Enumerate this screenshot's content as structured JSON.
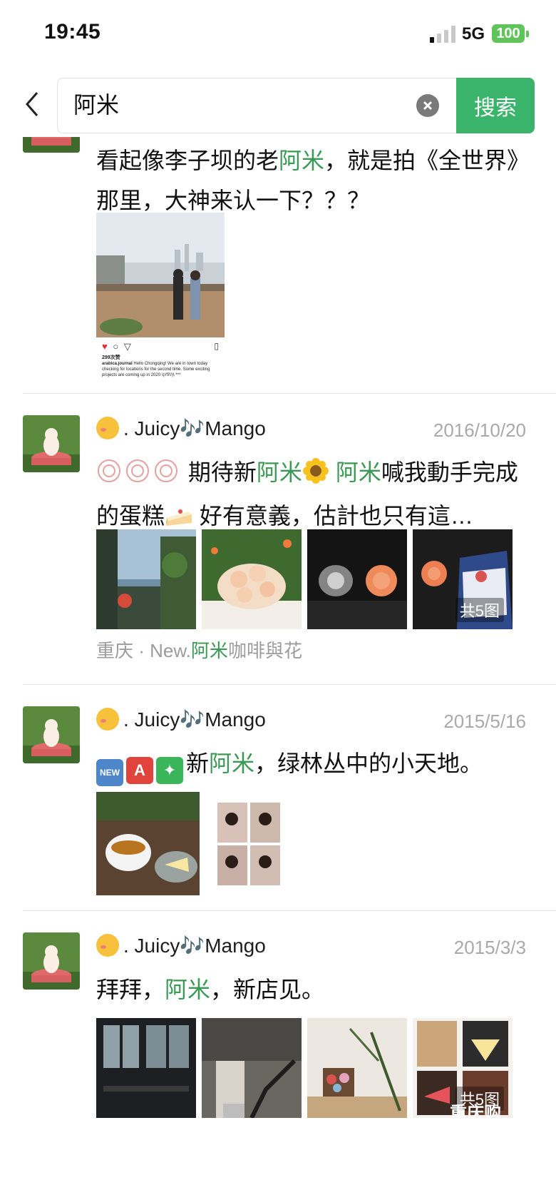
{
  "status_bar": {
    "time": "19:45",
    "network": "5G",
    "battery": "100"
  },
  "search": {
    "query": "阿米",
    "button_label": "搜索"
  },
  "posts": [
    {
      "text": [
        "看起像李子坝的老",
        "阿米",
        "，就是拍《全世界》那里，大神来认一下？？？"
      ],
      "instagram": {
        "likes": "299次赞",
        "caption_user": "arabica.journal",
        "caption": "Hello Chongqing!  We are in town today checking for locations for the second time. Some exciting projects are coming up in 2020 \\(//∇//)\\ ***"
      }
    },
    {
      "author": ". Juicy🎶Mango",
      "date": "2016/10/20",
      "text": [
        "期待新",
        "阿米",
        "阿米",
        "喊我動手完成的蛋糕",
        "好有意義，估計也只有這…"
      ],
      "photo_count": "共5图",
      "location": [
        "重庆 · New.",
        "阿米",
        "咖啡與花"
      ]
    },
    {
      "author": ". Juicy🎶Mango",
      "date": "2015/5/16",
      "badges": [
        "NEW",
        "A"
      ],
      "text": [
        "新",
        "阿米",
        "，绿林丛中的小天地。"
      ]
    },
    {
      "author": ". Juicy🎶Mango",
      "date": "2015/3/3",
      "text": [
        "拜拜，",
        "阿米",
        "，新店见。"
      ],
      "photo_count": "共5图",
      "watermark": "重庆购"
    }
  ],
  "colors": {
    "highlight": "#3a9a55",
    "search_button": "#3ab36b",
    "battery": "#5fc55a",
    "date": "#a9a9a9"
  }
}
